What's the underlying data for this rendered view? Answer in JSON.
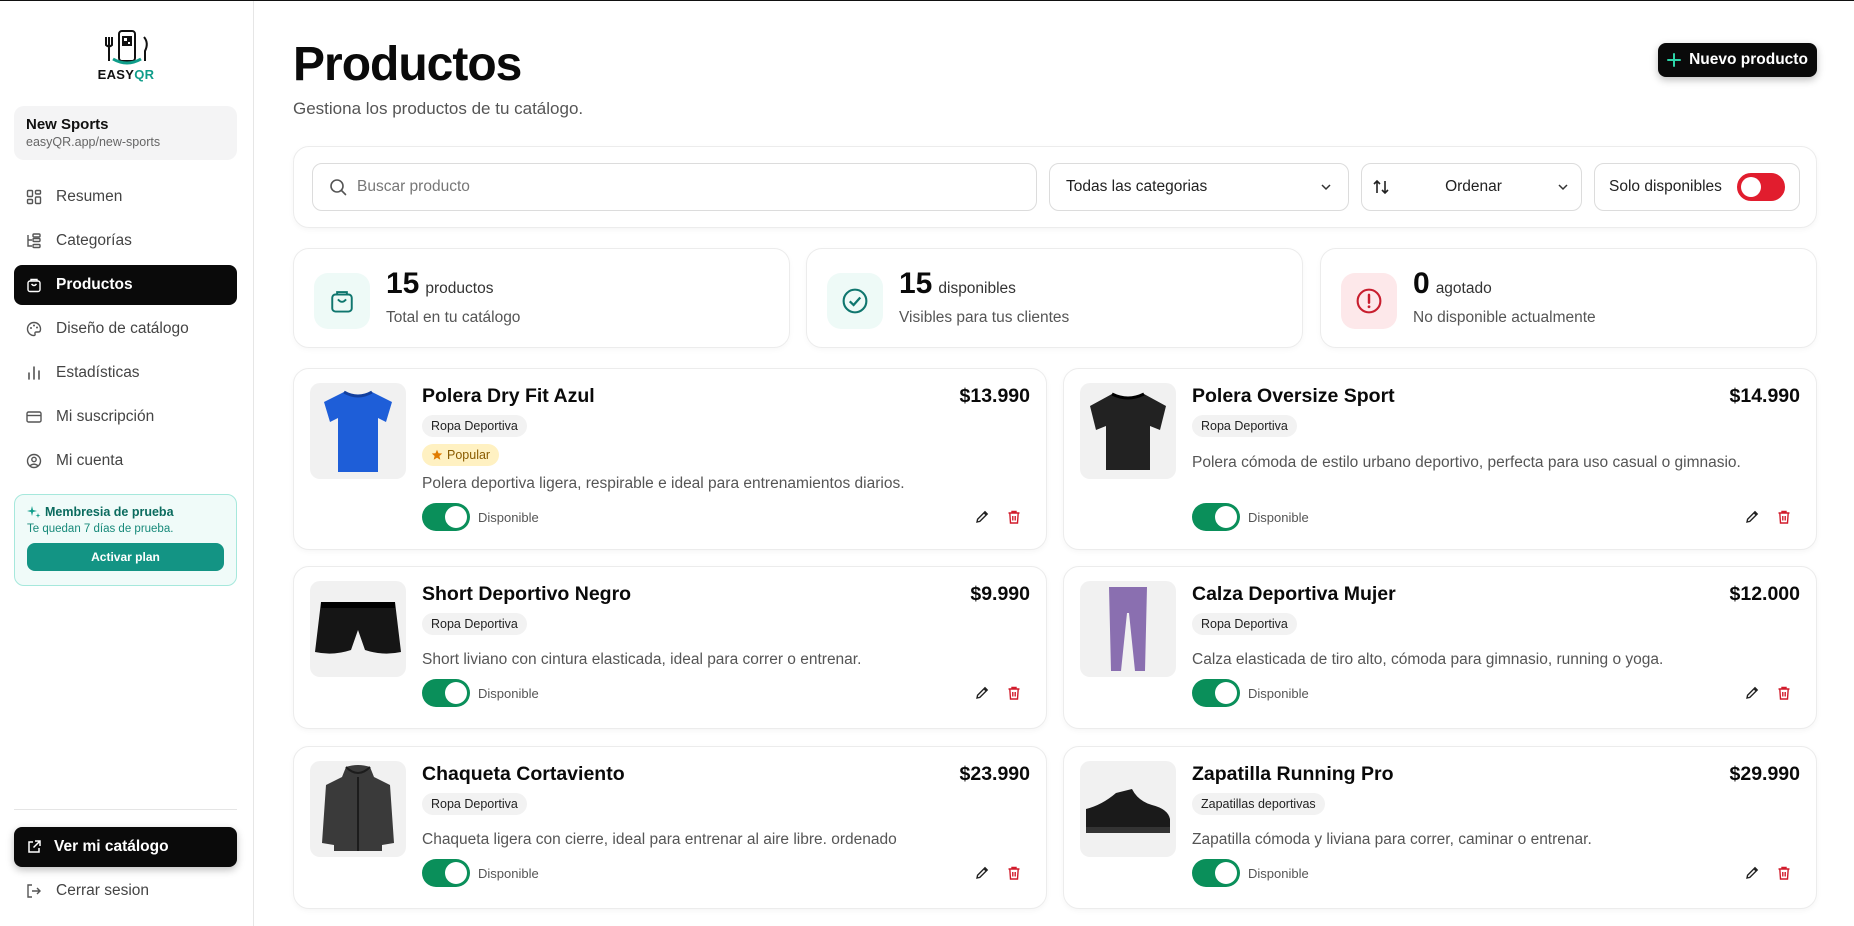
{
  "sidebar": {
    "logo_text_a": "EASY",
    "logo_text_b": "QR",
    "store_name": "New Sports",
    "store_url": "easyQR.app/new-sports",
    "nav": [
      {
        "label": "Resumen",
        "icon": "dashboard-icon"
      },
      {
        "label": "Categorías",
        "icon": "categories-icon"
      },
      {
        "label": "Productos",
        "icon": "shopping-bag-icon",
        "active": true
      },
      {
        "label": "Diseño de catálogo",
        "icon": "palette-icon"
      },
      {
        "label": "Estadísticas",
        "icon": "bar-chart-icon"
      },
      {
        "label": "Mi suscripción",
        "icon": "credit-card-icon"
      },
      {
        "label": "Mi cuenta",
        "icon": "user-circle-icon"
      }
    ],
    "trial": {
      "title": "Membresia de prueba",
      "subtitle": "Te quedan 7 días de prueba.",
      "button": "Activar plan"
    },
    "view_catalog": "Ver mi catálogo",
    "logout": "Cerrar sesion"
  },
  "header": {
    "title": "Productos",
    "subtitle": "Gestiona los productos de tu catálogo.",
    "new_button": "Nuevo producto"
  },
  "filters": {
    "search_placeholder": "Buscar producto",
    "category": "Todas las categorias",
    "sort": "Ordenar",
    "only_available": "Solo disponibles",
    "only_available_on": false
  },
  "stats": [
    {
      "number": "15",
      "unit": "productos",
      "desc": "Total en tu catálogo",
      "icon": "shopping-bag-icon",
      "color": "#0f766e",
      "bg": "#eefaf7"
    },
    {
      "number": "15",
      "unit": "disponibles",
      "desc": "Visibles para tus clientes",
      "icon": "check-circle-icon",
      "color": "#0f766e",
      "bg": "#eefaf7"
    },
    {
      "number": "0",
      "unit": "agotado",
      "desc": "No disponible actualmente",
      "icon": "alert-circle-icon",
      "color": "#c81e2e",
      "bg": "#fde8ea"
    }
  ],
  "products": [
    {
      "name": "Polera Dry Fit Azul",
      "price": "$13.990",
      "category": "Ropa Deportiva",
      "badge": "Popular",
      "desc": "Polera deportiva ligera, respirable e ideal para entrenamientos diarios.",
      "status": "Disponible",
      "available": true,
      "image": "blue-tshirt"
    },
    {
      "name": "Polera Oversize Sport",
      "price": "$14.990",
      "category": "Ropa Deportiva",
      "desc": "Polera cómoda de estilo urbano deportivo, perfecta para uso casual o gimnasio.",
      "status": "Disponible",
      "available": true,
      "image": "black-tshirt"
    },
    {
      "name": "Short Deportivo Negro",
      "price": "$9.990",
      "category": "Ropa Deportiva",
      "desc": "Short liviano con cintura elasticada, ideal para correr o entrenar.",
      "status": "Disponible",
      "available": true,
      "image": "black-shorts"
    },
    {
      "name": "Calza Deportiva Mujer",
      "price": "$12.000",
      "category": "Ropa Deportiva",
      "desc": "Calza elasticada de tiro alto, cómoda para gimnasio, running o yoga.",
      "status": "Disponible",
      "available": true,
      "image": "purple-leggings"
    },
    {
      "name": "Chaqueta Cortaviento",
      "price": "$23.990",
      "category": "Ropa Deportiva",
      "desc": "Chaqueta ligera con cierre, ideal para entrenar al aire libre. ordenado",
      "status": "Disponible",
      "available": true,
      "image": "grey-jacket"
    },
    {
      "name": "Zapatilla Running Pro",
      "price": "$29.990",
      "category": "Zapatillas deportivas",
      "desc": "Zapatilla cómoda y liviana para correr, caminar o entrenar.",
      "status": "Disponible",
      "available": true,
      "image": "black-sneaker"
    }
  ]
}
